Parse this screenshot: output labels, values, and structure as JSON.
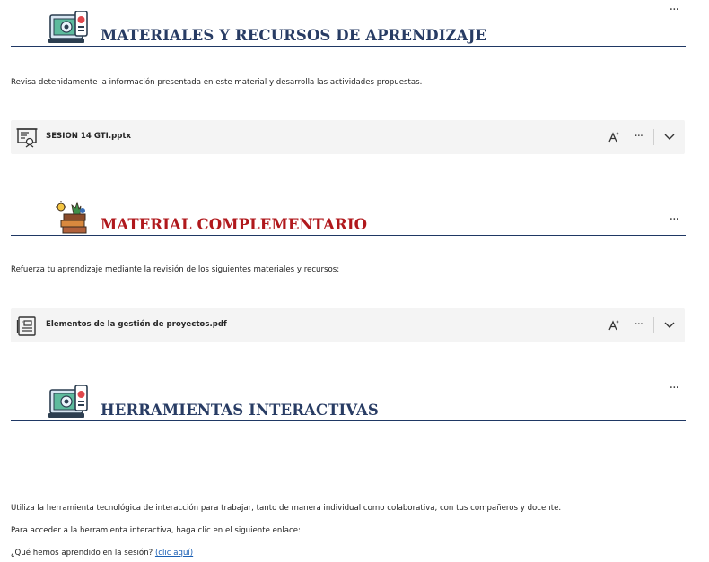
{
  "sections": [
    {
      "title": "MATERIALES Y RECURSOS DE APRENDIZAJE",
      "description": "Revisa detenidamente la información presentada en este material y desarrolla las actividades propuestas.",
      "file": {
        "name": "SESION 14 GTI.pptx",
        "icon": "presentation-file-icon"
      },
      "more_label": "···"
    },
    {
      "title": "MATERIAL COMPLEMENTARIO",
      "description": "Refuerza tu aprendizaje mediante la revisión de los siguientes materiales y recursos:",
      "file": {
        "name": "Elementos de la gestión de proyectos.pdf",
        "icon": "document-file-icon"
      },
      "more_label": "···"
    },
    {
      "title": "HERRAMIENTAS INTERACTIVAS",
      "more_label": "···",
      "paragraphs": [
        "Utiliza la herramienta tecnológica de interacción para trabajar, tanto de manera individual como colaborativa, con tus compañeros y docente.",
        "Para acceder a la herramienta interactiva, haga clic en el siguiente enlace:"
      ],
      "question_text": "¿Qué hemos aprendido en la sesión?",
      "link_text": "(clic aquí)"
    }
  ],
  "file_actions": {
    "more_label": "···"
  },
  "colors": {
    "navy_title": "#283c64",
    "red_title": "#b0181c",
    "rule": "#1f3864",
    "row_bg": "#f4f4f4",
    "link": "#1a5fb4"
  }
}
